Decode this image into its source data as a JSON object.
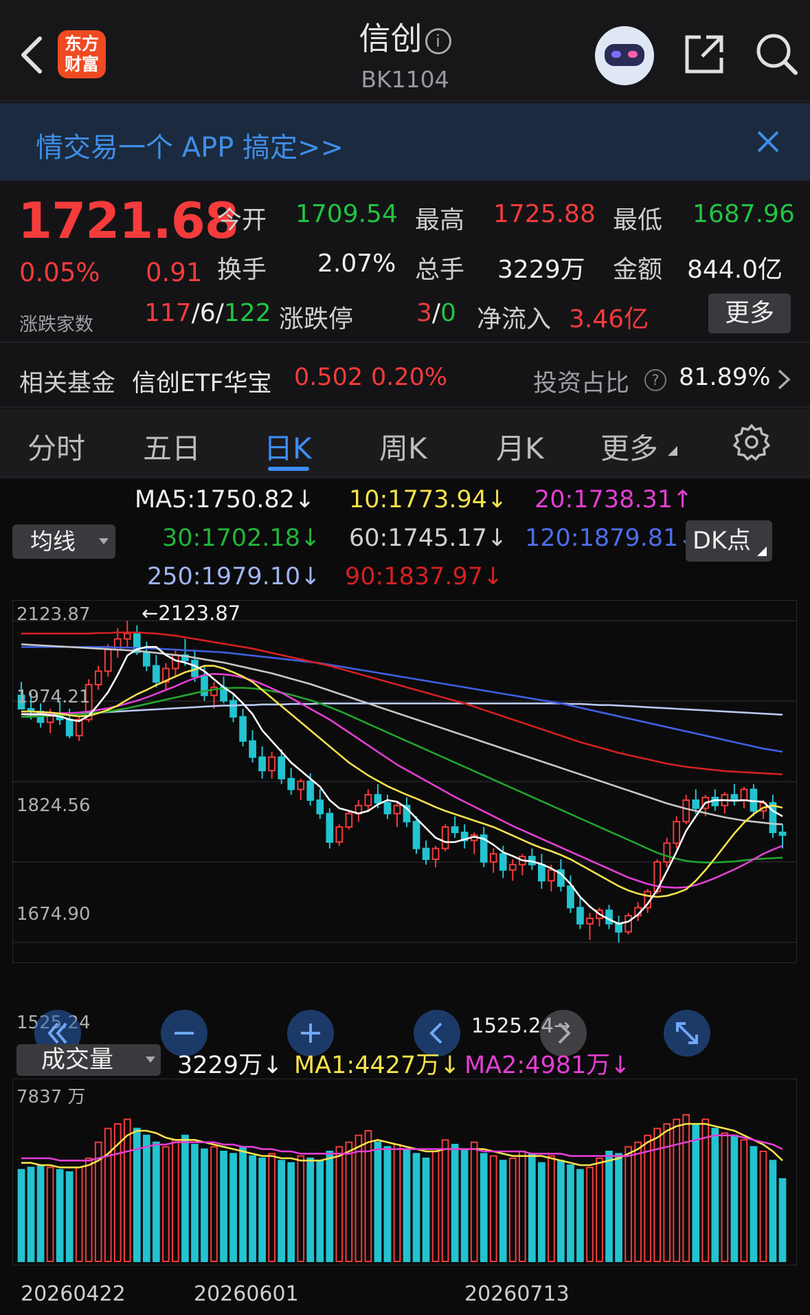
{
  "header": {
    "title": "信创",
    "code": "BK1104",
    "logo_text": "东方财富"
  },
  "banner": {
    "text": "情交易一个 APP 搞定>>"
  },
  "quote": {
    "price": "1721.68",
    "change_pct": "0.05%",
    "change": "0.91",
    "open_label": "今开",
    "open": "1709.54",
    "high_label": "最高",
    "high": "1725.88",
    "low_label": "最低",
    "low": "1687.96",
    "turnover_label": "换手",
    "turnover": "2.07%",
    "volume_label": "总手",
    "volume": "3229万",
    "amount_label": "金额",
    "amount": "844.0亿",
    "breadth_label": "涨跌家数",
    "breadth_up": "117",
    "breadth_flat": "6",
    "breadth_down": "122",
    "limit_label": "涨跌停",
    "limit_up": "3",
    "limit_down": "0",
    "inflow_label": "净流入",
    "inflow": "3.46亿",
    "more_label": "更多",
    "sep": "/"
  },
  "fund": {
    "label": "相关基金",
    "name": "信创ETF华宝",
    "price": "0.502",
    "pct": "0.20%",
    "ratio_label": "投资占比",
    "ratio": "81.89%"
  },
  "tabs": [
    "分时",
    "五日",
    "日K",
    "周K",
    "月K",
    "更多"
  ],
  "active_tab": 2,
  "ma": {
    "selector_label": "均线",
    "dk_label": "DK点",
    "ma5": "MA5:1750.82↓",
    "ma10": "10:1773.94↓",
    "ma20": "20:1738.31↑",
    "ma30": "30:1702.18↓",
    "ma60": "60:1745.17↓",
    "ma120": "120:1879.81↓",
    "ma250": "250:1979.10↓",
    "ma90": "90:1837.97↓"
  },
  "colors": {
    "up": "#f53b3b",
    "down": "#23c3d0",
    "ma5": "#ffffff",
    "ma10": "#f7e24b",
    "ma20": "#e33fd4",
    "ma30": "#21a52d",
    "ma60": "#c8c8c8",
    "ma120": "#3f5fe0",
    "ma250": "#b9c8f2",
    "ma90": "#d42020"
  },
  "price_axis": {
    "labels": [
      "2123.87",
      "1974.21",
      "1824.56",
      "1674.90",
      "1525.24"
    ],
    "max_marker": "←2123.87",
    "min_marker": "1525.24→"
  },
  "volume": {
    "selector_label": "成交量",
    "vol": "3229万↓",
    "ma1": "MA1:4427万↓",
    "ma2": "MA2:4981万↓",
    "axis_top": "7837 万"
  },
  "dates": [
    "20260422",
    "20260601",
    "20260713"
  ],
  "chart_data": {
    "type": "candlestick",
    "ylim": [
      1525.24,
      2123.87
    ],
    "candles": [
      [
        1985,
        2010,
        1960,
        1960
      ],
      [
        1960,
        1990,
        1940,
        1955
      ],
      [
        1955,
        1970,
        1925,
        1935
      ],
      [
        1935,
        1960,
        1915,
        1950
      ],
      [
        1950,
        1975,
        1930,
        1940
      ],
      [
        1940,
        1960,
        1905,
        1910
      ],
      [
        1910,
        1945,
        1900,
        1940
      ],
      [
        1940,
        2015,
        1935,
        2005
      ],
      [
        2005,
        2040,
        1995,
        2030
      ],
      [
        2030,
        2080,
        2020,
        2070
      ],
      [
        2070,
        2110,
        2055,
        2090
      ],
      [
        2090,
        2123.87,
        2075,
        2100
      ],
      [
        2100,
        2115,
        2060,
        2065
      ],
      [
        2065,
        2085,
        2030,
        2040
      ],
      [
        2040,
        2060,
        2000,
        2010
      ],
      [
        2010,
        2045,
        1995,
        2035
      ],
      [
        2035,
        2070,
        2020,
        2060
      ],
      [
        2060,
        2090,
        2040,
        2050
      ],
      [
        2050,
        2070,
        2010,
        2020
      ],
      [
        2020,
        2040,
        1975,
        1985
      ],
      [
        1985,
        2010,
        1960,
        2000
      ],
      [
        2000,
        2020,
        1970,
        1975
      ],
      [
        1975,
        1990,
        1935,
        1945
      ],
      [
        1945,
        1960,
        1890,
        1900
      ],
      [
        1900,
        1920,
        1860,
        1870
      ],
      [
        1870,
        1890,
        1830,
        1845
      ],
      [
        1845,
        1880,
        1830,
        1870
      ],
      [
        1870,
        1885,
        1820,
        1830
      ],
      [
        1830,
        1850,
        1800,
        1810
      ],
      [
        1810,
        1830,
        1790,
        1825
      ],
      [
        1825,
        1840,
        1780,
        1790
      ],
      [
        1790,
        1810,
        1755,
        1765
      ],
      [
        1765,
        1775,
        1700,
        1712
      ],
      [
        1712,
        1745,
        1705,
        1740
      ],
      [
        1740,
        1770,
        1735,
        1765
      ],
      [
        1765,
        1790,
        1750,
        1780
      ],
      [
        1780,
        1810,
        1768,
        1800
      ],
      [
        1800,
        1820,
        1775,
        1785
      ],
      [
        1785,
        1800,
        1755,
        1765
      ],
      [
        1765,
        1785,
        1740,
        1780
      ],
      [
        1780,
        1795,
        1740,
        1750
      ],
      [
        1750,
        1760,
        1690,
        1700
      ],
      [
        1700,
        1715,
        1670,
        1680
      ],
      [
        1680,
        1705,
        1665,
        1700
      ],
      [
        1700,
        1745,
        1695,
        1740
      ],
      [
        1740,
        1760,
        1720,
        1730
      ],
      [
        1730,
        1745,
        1700,
        1715
      ],
      [
        1715,
        1730,
        1690,
        1725
      ],
      [
        1725,
        1740,
        1665,
        1675
      ],
      [
        1675,
        1700,
        1655,
        1690
      ],
      [
        1690,
        1705,
        1645,
        1660
      ],
      [
        1660,
        1680,
        1640,
        1670
      ],
      [
        1670,
        1690,
        1650,
        1685
      ],
      [
        1685,
        1700,
        1660,
        1670
      ],
      [
        1670,
        1690,
        1625,
        1640
      ],
      [
        1640,
        1670,
        1620,
        1660
      ],
      [
        1660,
        1680,
        1620,
        1630
      ],
      [
        1630,
        1650,
        1580,
        1590
      ],
      [
        1590,
        1610,
        1550,
        1560
      ],
      [
        1560,
        1580,
        1530,
        1570
      ],
      [
        1570,
        1590,
        1555,
        1585
      ],
      [
        1585,
        1595,
        1550,
        1560
      ],
      [
        1560,
        1575,
        1525.24,
        1545
      ],
      [
        1545,
        1580,
        1540,
        1575
      ],
      [
        1575,
        1600,
        1565,
        1590
      ],
      [
        1590,
        1625,
        1580,
        1620
      ],
      [
        1620,
        1680,
        1615,
        1675
      ],
      [
        1675,
        1720,
        1665,
        1710
      ],
      [
        1710,
        1760,
        1700,
        1750
      ],
      [
        1750,
        1800,
        1745,
        1790
      ],
      [
        1790,
        1810,
        1765,
        1775
      ],
      [
        1775,
        1800,
        1760,
        1795
      ],
      [
        1795,
        1810,
        1770,
        1780
      ],
      [
        1780,
        1805,
        1765,
        1800
      ],
      [
        1800,
        1820,
        1780,
        1790
      ],
      [
        1790,
        1815,
        1775,
        1810
      ],
      [
        1810,
        1820,
        1760,
        1770
      ],
      [
        1770,
        1790,
        1755,
        1785
      ],
      [
        1785,
        1800,
        1720,
        1730
      ],
      [
        1730,
        1745,
        1700,
        1725
      ]
    ],
    "volumes": [
      40,
      41,
      42,
      41,
      40,
      39,
      41,
      45,
      52,
      58,
      60,
      62,
      58,
      55,
      52,
      50,
      53,
      55,
      51,
      49,
      50,
      48,
      47,
      50,
      46,
      45,
      47,
      44,
      43,
      46,
      45,
      44,
      48,
      50,
      52,
      55,
      57,
      52,
      50,
      51,
      49,
      47,
      45,
      48,
      53,
      51,
      49,
      52,
      47,
      46,
      44,
      45,
      48,
      47,
      43,
      46,
      44,
      42,
      40,
      41,
      45,
      48,
      47,
      50,
      52,
      55,
      58,
      60,
      62,
      64,
      60,
      62,
      58,
      56,
      55,
      53,
      50,
      48,
      44,
      36
    ],
    "ma_lines": {
      "ma5": [
        1950,
        1950,
        1950,
        1948,
        1946,
        1940,
        1937,
        1947,
        1968,
        1991,
        2023,
        2059,
        2071,
        2075,
        2075,
        2060,
        2050,
        2046,
        2040,
        2030,
        2015,
        2000,
        1988,
        1970,
        1950,
        1920,
        1900,
        1880,
        1860,
        1845,
        1830,
        1815,
        1790,
        1775,
        1770,
        1765,
        1770,
        1782,
        1790,
        1787,
        1775,
        1756,
        1738,
        1720,
        1712,
        1712,
        1717,
        1722,
        1718,
        1707,
        1693,
        1686,
        1678,
        1676,
        1671,
        1663,
        1653,
        1634,
        1610,
        1592,
        1578,
        1568,
        1560,
        1564,
        1577,
        1597,
        1623,
        1658,
        1694,
        1733,
        1760,
        1785,
        1790,
        1790,
        1789,
        1790,
        1788,
        1787,
        1770,
        1760
      ],
      "ma10": [
        1955,
        1955,
        1954,
        1953,
        1951,
        1948,
        1946,
        1947,
        1952,
        1958,
        1966,
        1977,
        1987,
        1995,
        2004,
        2012,
        2020,
        2028,
        2033,
        2040,
        2040,
        2035,
        2028,
        2020,
        2010,
        1995,
        1980,
        1965,
        1950,
        1935,
        1920,
        1905,
        1890,
        1875,
        1860,
        1848,
        1836,
        1826,
        1816,
        1808,
        1800,
        1793,
        1785,
        1777,
        1770,
        1764,
        1758,
        1752,
        1746,
        1740,
        1732,
        1724,
        1716,
        1708,
        1701,
        1695,
        1688,
        1680,
        1670,
        1660,
        1650,
        1640,
        1630,
        1622,
        1616,
        1612,
        1610,
        1612,
        1617,
        1624,
        1640,
        1660,
        1682,
        1705,
        1728,
        1748,
        1764,
        1776,
        1780,
        1776
      ],
      "ma20": [
        1950,
        1950,
        1950,
        1951,
        1952,
        1952,
        1953,
        1955,
        1958,
        1961,
        1965,
        1970,
        1975,
        1981,
        1988,
        1995,
        2002,
        2010,
        2017,
        2023,
        2025,
        2024,
        2022,
        2018,
        2013,
        2006,
        1998,
        1990,
        1980,
        1970,
        1960,
        1950,
        1940,
        1928,
        1916,
        1904,
        1892,
        1880,
        1868,
        1856,
        1846,
        1836,
        1826,
        1816,
        1806,
        1796,
        1787,
        1778,
        1769,
        1760,
        1751,
        1742,
        1734,
        1726,
        1718,
        1710,
        1702,
        1694,
        1686,
        1678,
        1670,
        1662,
        1654,
        1646,
        1640,
        1634,
        1630,
        1628,
        1627,
        1628,
        1632,
        1638,
        1645,
        1653,
        1661,
        1670,
        1680,
        1690,
        1698,
        1705
      ],
      "ma30": [
        1945,
        1945,
        1946,
        1947,
        1948,
        1949,
        1950,
        1951,
        1953,
        1955,
        1958,
        1961,
        1965,
        1969,
        1973,
        1977,
        1981,
        1985,
        1989,
        1993,
        1996,
        1998,
        1999,
        1999,
        1998,
        1996,
        1993,
        1990,
        1986,
        1981,
        1976,
        1970,
        1963,
        1956,
        1948,
        1940,
        1932,
        1924,
        1916,
        1908,
        1900,
        1892,
        1884,
        1876,
        1868,
        1860,
        1852,
        1844,
        1836,
        1828,
        1820,
        1812,
        1804,
        1796,
        1788,
        1780,
        1772,
        1764,
        1756,
        1748,
        1740,
        1732,
        1724,
        1716,
        1708,
        1700,
        1692,
        1686,
        1681,
        1677,
        1675,
        1674,
        1674,
        1675,
        1676,
        1678,
        1680,
        1681,
        1682,
        1683
      ],
      "ma60": [
        2080,
        2079,
        2078,
        2077,
        2076,
        2075,
        2074,
        2073,
        2072,
        2071,
        2070,
        2069,
        2068,
        2066,
        2064,
        2062,
        2060,
        2058,
        2055,
        2052,
        2049,
        2046,
        2042,
        2038,
        2034,
        2030,
        2026,
        2021,
        2016,
        2011,
        2006,
        2000,
        1994,
        1988,
        1982,
        1976,
        1970,
        1964,
        1958,
        1952,
        1946,
        1940,
        1934,
        1928,
        1922,
        1916,
        1910,
        1904,
        1898,
        1892,
        1886,
        1880,
        1874,
        1868,
        1862,
        1856,
        1850,
        1844,
        1838,
        1832,
        1826,
        1820,
        1814,
        1808,
        1802,
        1796,
        1790,
        1784,
        1779,
        1774,
        1770,
        1766,
        1762,
        1758,
        1755,
        1752,
        1750,
        1748,
        1746,
        1745
      ],
      "ma90": [
        2100,
        2100,
        2100,
        2100,
        2100,
        2100,
        2100,
        2100,
        2101,
        2101,
        2102,
        2102,
        2102,
        2101,
        2100,
        2098,
        2096,
        2093,
        2090,
        2087,
        2084,
        2081,
        2078,
        2075,
        2072,
        2068,
        2064,
        2060,
        2056,
        2052,
        2048,
        2044,
        2040,
        2035,
        2030,
        2025,
        2020,
        2015,
        2010,
        2005,
        2000,
        1995,
        1990,
        1985,
        1980,
        1975,
        1970,
        1964,
        1958,
        1952,
        1946,
        1940,
        1934,
        1928,
        1922,
        1916,
        1910,
        1904,
        1898,
        1893,
        1888,
        1883,
        1878,
        1874,
        1870,
        1866,
        1862,
        1858,
        1855,
        1852,
        1850,
        1848,
        1846,
        1844,
        1843,
        1842,
        1841,
        1840,
        1839,
        1838
      ],
      "ma120": [
        2075,
        2075,
        2075,
        2075,
        2075,
        2075,
        2075,
        2075,
        2075,
        2075,
        2074,
        2074,
        2073,
        2073,
        2072,
        2071,
        2070,
        2069,
        2068,
        2067,
        2066,
        2065,
        2063,
        2061,
        2059,
        2057,
        2055,
        2053,
        2051,
        2049,
        2047,
        2045,
        2042,
        2039,
        2036,
        2033,
        2030,
        2027,
        2024,
        2021,
        2018,
        2015,
        2012,
        2009,
        2006,
        2003,
        2000,
        1997,
        1994,
        1991,
        1988,
        1985,
        1982,
        1979,
        1976,
        1973,
        1970,
        1966,
        1962,
        1958,
        1954,
        1950,
        1946,
        1942,
        1938,
        1934,
        1930,
        1926,
        1922,
        1918,
        1914,
        1910,
        1906,
        1902,
        1898,
        1894,
        1890,
        1886,
        1883,
        1880
      ],
      "ma250": [
        1945,
        1946,
        1947,
        1948,
        1949,
        1950,
        1951,
        1952,
        1953,
        1954,
        1955,
        1956,
        1957,
        1958,
        1959,
        1960,
        1961,
        1962,
        1963,
        1964,
        1965,
        1966,
        1966,
        1967,
        1967,
        1968,
        1968,
        1968,
        1969,
        1969,
        1969,
        1970,
        1970,
        1970,
        1970,
        1970,
        1970,
        1970,
        1970,
        1970,
        1970,
        1970,
        1970,
        1970,
        1970,
        1970,
        1970,
        1970,
        1970,
        1970,
        1970,
        1970,
        1970,
        1970,
        1970,
        1970,
        1970,
        1969,
        1969,
        1968,
        1967,
        1967,
        1966,
        1965,
        1964,
        1963,
        1962,
        1961,
        1960,
        1959,
        1958,
        1957,
        1956,
        1955,
        1954,
        1953,
        1952,
        1951,
        1950,
        1949
      ]
    },
    "vol_ma": {
      "ma1": [
        43,
        43,
        42,
        42,
        41,
        41,
        41,
        42,
        44,
        47,
        51,
        55,
        57,
        57,
        56,
        54,
        53,
        53,
        53,
        52,
        51,
        50,
        49,
        48,
        47,
        46,
        46,
        45,
        45,
        44,
        44,
        44,
        45,
        46,
        48,
        50,
        52,
        53,
        52,
        51,
        50,
        49,
        48,
        48,
        49,
        49,
        49,
        49,
        49,
        48,
        47,
        46,
        46,
        46,
        46,
        45,
        44,
        43,
        42,
        42,
        43,
        44,
        45,
        47,
        49,
        52,
        54,
        57,
        59,
        60,
        60,
        60,
        59,
        58,
        57,
        55,
        53,
        51,
        48,
        44
      ],
      "ma2": [
        45,
        45,
        45,
        45,
        44,
        44,
        44,
        44,
        45,
        46,
        47,
        48,
        49,
        50,
        51,
        51,
        52,
        52,
        52,
        52,
        52,
        51,
        51,
        50,
        50,
        49,
        49,
        48,
        48,
        47,
        47,
        47,
        47,
        47,
        47,
        48,
        48,
        49,
        49,
        49,
        49,
        49,
        49,
        49,
        49,
        49,
        49,
        49,
        48,
        48,
        48,
        48,
        48,
        47,
        47,
        47,
        47,
        46,
        46,
        46,
        46,
        46,
        46,
        46,
        47,
        48,
        49,
        50,
        51,
        52,
        53,
        54,
        55,
        55,
        55,
        54,
        53,
        52,
        51,
        49
      ]
    }
  }
}
